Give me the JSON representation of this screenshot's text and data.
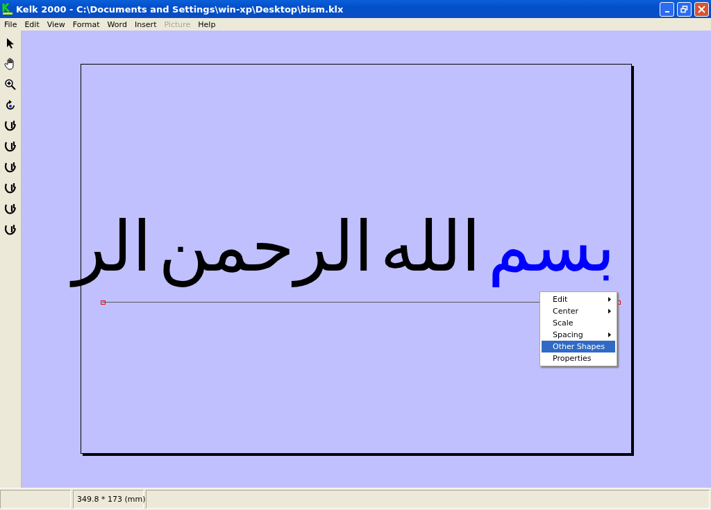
{
  "window": {
    "title": "Kelk 2000 - C:\\Documents and Settings\\win-xp\\Desktop\\bism.klx"
  },
  "menu_bar": [
    {
      "label": "File",
      "disabled": false
    },
    {
      "label": "Edit",
      "disabled": false
    },
    {
      "label": "View",
      "disabled": false
    },
    {
      "label": "Format",
      "disabled": false
    },
    {
      "label": "Word",
      "disabled": false
    },
    {
      "label": "Insert",
      "disabled": false
    },
    {
      "label": "Picture",
      "disabled": true
    },
    {
      "label": "Help",
      "disabled": false
    }
  ],
  "tools": [
    {
      "kind": "pointer"
    },
    {
      "kind": "hand"
    },
    {
      "kind": "zoom"
    },
    {
      "kind": "rotate"
    },
    {
      "kind": "glyph"
    },
    {
      "kind": "glyph"
    },
    {
      "kind": "glyph"
    },
    {
      "kind": "glyph"
    },
    {
      "kind": "glyph"
    },
    {
      "kind": "glyph"
    }
  ],
  "canvas": {
    "words": [
      {
        "text": "بسم",
        "selected": true
      },
      {
        "text": "الله",
        "selected": false
      },
      {
        "text": "الرحمن",
        "selected": false
      },
      {
        "text": "الر",
        "selected": false
      }
    ]
  },
  "context_menu": [
    {
      "label": "Edit",
      "submenu": true,
      "selected": false
    },
    {
      "label": "Center",
      "submenu": true,
      "selected": false
    },
    {
      "label": "Scale",
      "submenu": false,
      "selected": false
    },
    {
      "label": "Spacing",
      "submenu": true,
      "selected": false
    },
    {
      "label": "Other Shapes",
      "submenu": false,
      "selected": true
    },
    {
      "label": "Properties",
      "submenu": false,
      "selected": false
    }
  ],
  "status_bar": {
    "dimensions": "349.8 * 173 (mm)"
  }
}
